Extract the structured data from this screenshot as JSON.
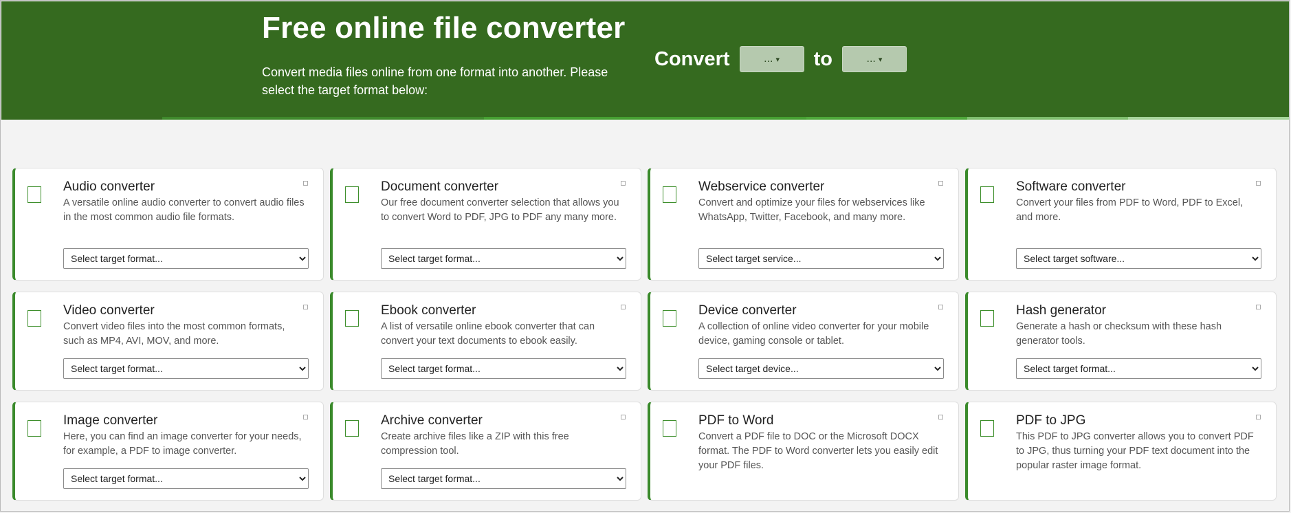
{
  "header": {
    "title": "Free online file converter",
    "subtitle": "Convert media files online from one format into another. Please select the target format below:",
    "convert_label": "Convert",
    "to_label": "to",
    "from_button": "...",
    "to_button": "...",
    "dropdown_icon": "caret-down-icon",
    "colors": {
      "background": "#356a1f",
      "stripe": [
        "#356a1f",
        "#3f8a2c",
        "#3f8a2c",
        "#46a032",
        "#46a032",
        "#4ea83a",
        "#7fbf6e",
        "#a6d49a"
      ]
    }
  },
  "cards": [
    {
      "title": "Audio converter",
      "desc": "A versatile online audio converter to convert audio files in the most common audio file formats.",
      "select": "Select target format..."
    },
    {
      "title": "Document converter",
      "desc": "Our free document converter selection that allows you to convert Word to PDF, JPG to PDF any many more.",
      "select": "Select target format..."
    },
    {
      "title": "Webservice converter",
      "desc": "Convert and optimize your files for webservices like WhatsApp, Twitter, Facebook, and many more.",
      "select": "Select target service..."
    },
    {
      "title": "Software converter",
      "desc": "Convert your files from PDF to Word, PDF to Excel, and more.",
      "select": "Select target software..."
    },
    {
      "title": "Video converter",
      "desc": "Convert video files into the most common formats, such as MP4, AVI, MOV, and more.",
      "select": "Select target format..."
    },
    {
      "title": "Ebook converter",
      "desc": "A list of versatile online ebook converter that can convert your text documents to ebook easily.",
      "select": "Select target format..."
    },
    {
      "title": "Device converter",
      "desc": "A collection of online video converter for your mobile device, gaming console or tablet.",
      "select": "Select target device..."
    },
    {
      "title": "Hash generator",
      "desc": "Generate a hash or checksum with these hash generator tools.",
      "select": "Select target format..."
    },
    {
      "title": "Image converter",
      "desc": "Here, you can find an image converter for your needs, for example, a PDF to image converter.",
      "select": "Select target format..."
    },
    {
      "title": "Archive converter",
      "desc": "Create archive files like a ZIP with this free compression tool.",
      "select": "Select target format..."
    },
    {
      "title": "PDF to Word",
      "desc": "Convert a PDF file to DOC or the Microsoft DOCX format. The PDF to Word converter lets you easily edit your PDF files.",
      "select": ""
    },
    {
      "title": "PDF to JPG",
      "desc": "This PDF to JPG converter allows you to convert PDF to JPG, thus turning your PDF text document into the popular raster image format.",
      "select": ""
    }
  ],
  "card_icons": {
    "check": "checkbox-icon",
    "corner": "expand-icon"
  },
  "accent_color": "#3a8a2b"
}
